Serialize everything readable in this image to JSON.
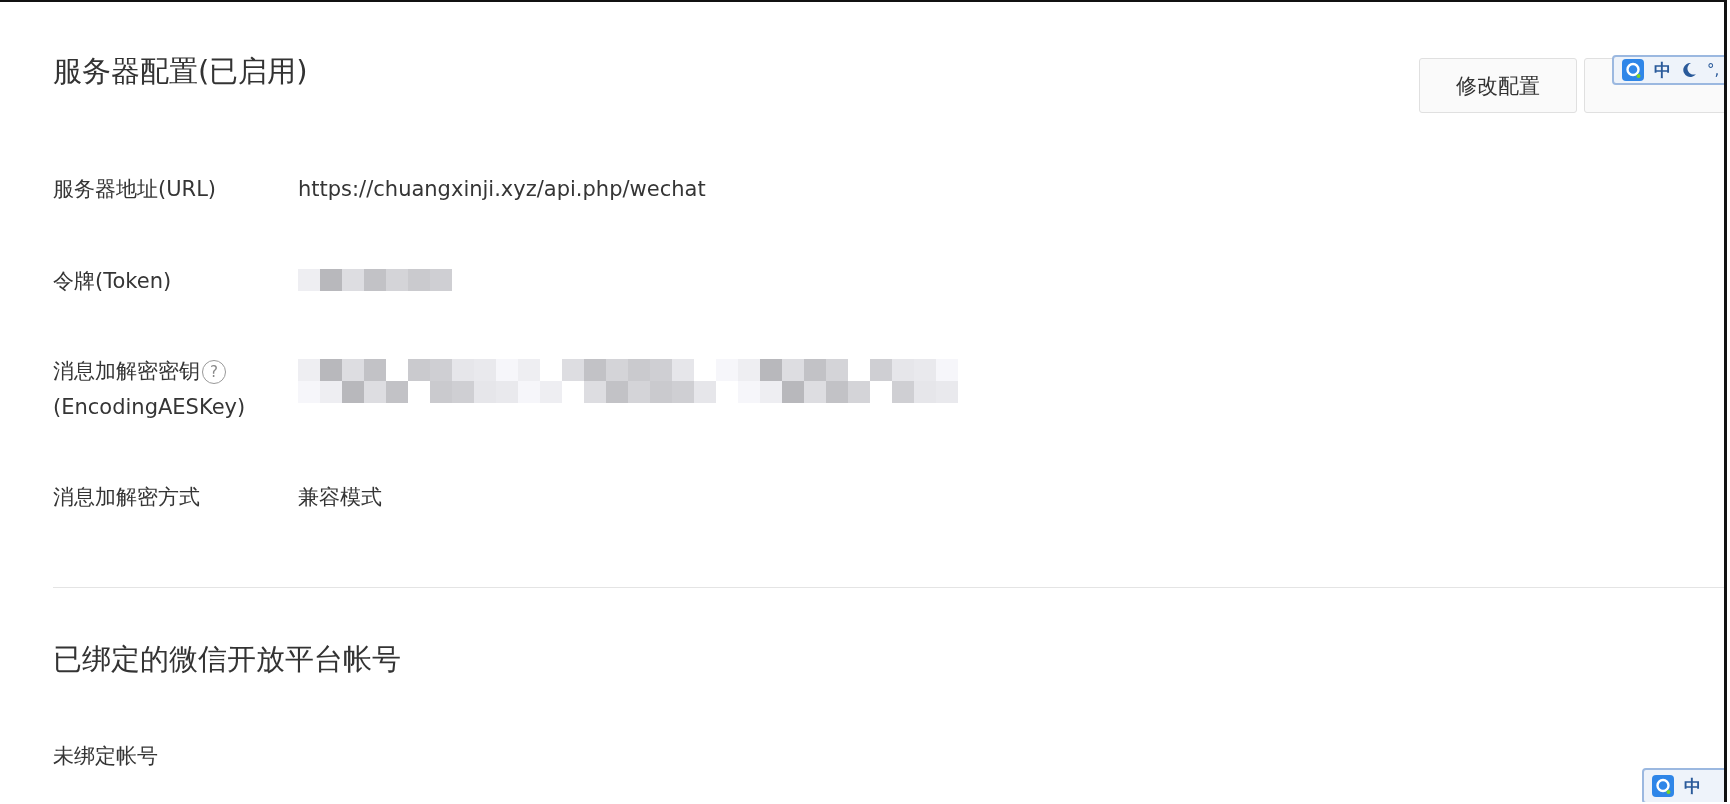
{
  "server_config": {
    "title": "服务器配置(已启用)",
    "buttons": [
      {
        "label": "修改配置",
        "kind": "text"
      },
      {
        "kind": "covered"
      }
    ],
    "fields": [
      {
        "label": "服务器地址(URL)",
        "kind": "text",
        "value": "https://chuangxinji.xyz/api.php/wechat"
      },
      {
        "label": "令牌(Token)",
        "kind": "redacted-short"
      },
      {
        "label": "消息加解密密钥",
        "label_2": "(EncodingAESKey)",
        "help": "?",
        "kind": "redacted-long"
      },
      {
        "label": "消息加解密方式",
        "kind": "text",
        "value": "兼容模式"
      }
    ]
  },
  "bound_accounts": {
    "title": "已绑定的微信开放平台帐号",
    "status": "未绑定帐号"
  },
  "ime_toolbars": [
    {
      "mode": "中",
      "punct": "°,"
    },
    {
      "mode": "中"
    }
  ]
}
